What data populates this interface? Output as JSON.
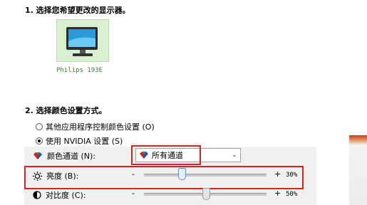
{
  "step1": {
    "title": "1. 选择您希望更改的显示器。"
  },
  "monitor": {
    "label": "Philips 193E"
  },
  "step2": {
    "title": "2. 选择颜色设置方式。"
  },
  "options": [
    {
      "label": "其他应用程序控制颜色设置 (O)",
      "checked": false
    },
    {
      "label": "使用 NVIDIA 设置 (S)",
      "checked": true
    }
  ],
  "color_channel": {
    "label": "颜色通道 (N):",
    "selected": "所有通道"
  },
  "brightness": {
    "label": "亮度 (B):",
    "minus": "-",
    "plus": "+",
    "value_text": "30%",
    "value": 30
  },
  "contrast": {
    "label": "对比度 (C):",
    "minus": "-",
    "plus": "+",
    "value_text": "50%",
    "value": 50
  },
  "colors": {
    "highlight": "#e02020",
    "thumb": "#6c8cc8"
  }
}
